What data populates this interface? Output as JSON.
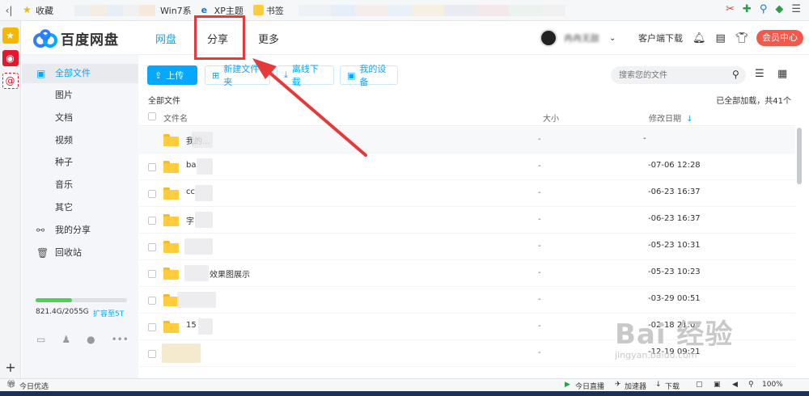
{
  "browser": {
    "back_glyph": "‹|",
    "bookmarks": [
      {
        "label": "收藏",
        "icon": "star-icon"
      },
      {
        "label": "Win7系",
        "icon": "blank-icon"
      },
      {
        "label": "XP主题",
        "icon": "ie-icon"
      },
      {
        "label": "书签",
        "icon": "folder-icon"
      }
    ],
    "sidebar_add": "+"
  },
  "app": {
    "logo_title": "百度网盘",
    "nav": [
      {
        "label": "网盘",
        "active": true
      },
      {
        "label": "分享",
        "active": false
      },
      {
        "label": "更多",
        "active": false
      }
    ],
    "user_name": "冉冉无敌",
    "client_download": "客户端下载",
    "vip_label": "会员中心"
  },
  "sidebar": {
    "items": [
      {
        "label": "全部文件",
        "icon": "document-icon",
        "active": true
      },
      {
        "label": "图片"
      },
      {
        "label": "文档"
      },
      {
        "label": "视频"
      },
      {
        "label": "种子"
      },
      {
        "label": "音乐"
      },
      {
        "label": "其它"
      },
      {
        "label": "我的分享",
        "icon": "share-icon"
      },
      {
        "label": "回收站",
        "icon": "trash-icon"
      }
    ],
    "storage_used": 0.4,
    "storage_text": "821.4G/2055G",
    "storage_link": "扩容至5T"
  },
  "toolbar": {
    "upload": "上传",
    "new_folder": "新建文件夹",
    "offline_download": "离线下载",
    "my_devices": "我的设备",
    "search_placeholder": "搜索您的文件"
  },
  "files": {
    "breadcrumb": "全部文件",
    "loaded_text": "已全部加载，共41个",
    "columns": {
      "name": "文件名",
      "size": "大小",
      "date": "修改日期"
    },
    "rows": [
      {
        "name": "我的...",
        "size": "-",
        "date": "-"
      },
      {
        "name": "ba",
        "size": "-",
        "date": "-07-06 12:28"
      },
      {
        "name": "cc",
        "size": "-",
        "date": "-06-23 16:37"
      },
      {
        "name": "字",
        "size": "-",
        "date": "-06-23 16:37"
      },
      {
        "name": "",
        "size": "-",
        "date": "-05-23 10:31"
      },
      {
        "name": "效果图展示",
        "size": "-",
        "date": "-05-23 10:23"
      },
      {
        "name": "",
        "size": "-",
        "date": "-03-29 00:51"
      },
      {
        "name": "15",
        "size": "-",
        "date": "-02-18 21:05"
      },
      {
        "name": "",
        "size": "-",
        "date": "-12-19 09:21"
      }
    ]
  },
  "watermark": {
    "main": "Bai 经验",
    "sub": "jingyan.baidu.com"
  },
  "status": {
    "left": "今日优选",
    "live": "今日直播",
    "accelerator": "加速器",
    "download": "下载",
    "zoom": "100%"
  },
  "colors": {
    "accent": "#06a7ff",
    "highlight": "#e63a3a",
    "vip": "#f2584b",
    "folder": "#ffcc3d"
  }
}
